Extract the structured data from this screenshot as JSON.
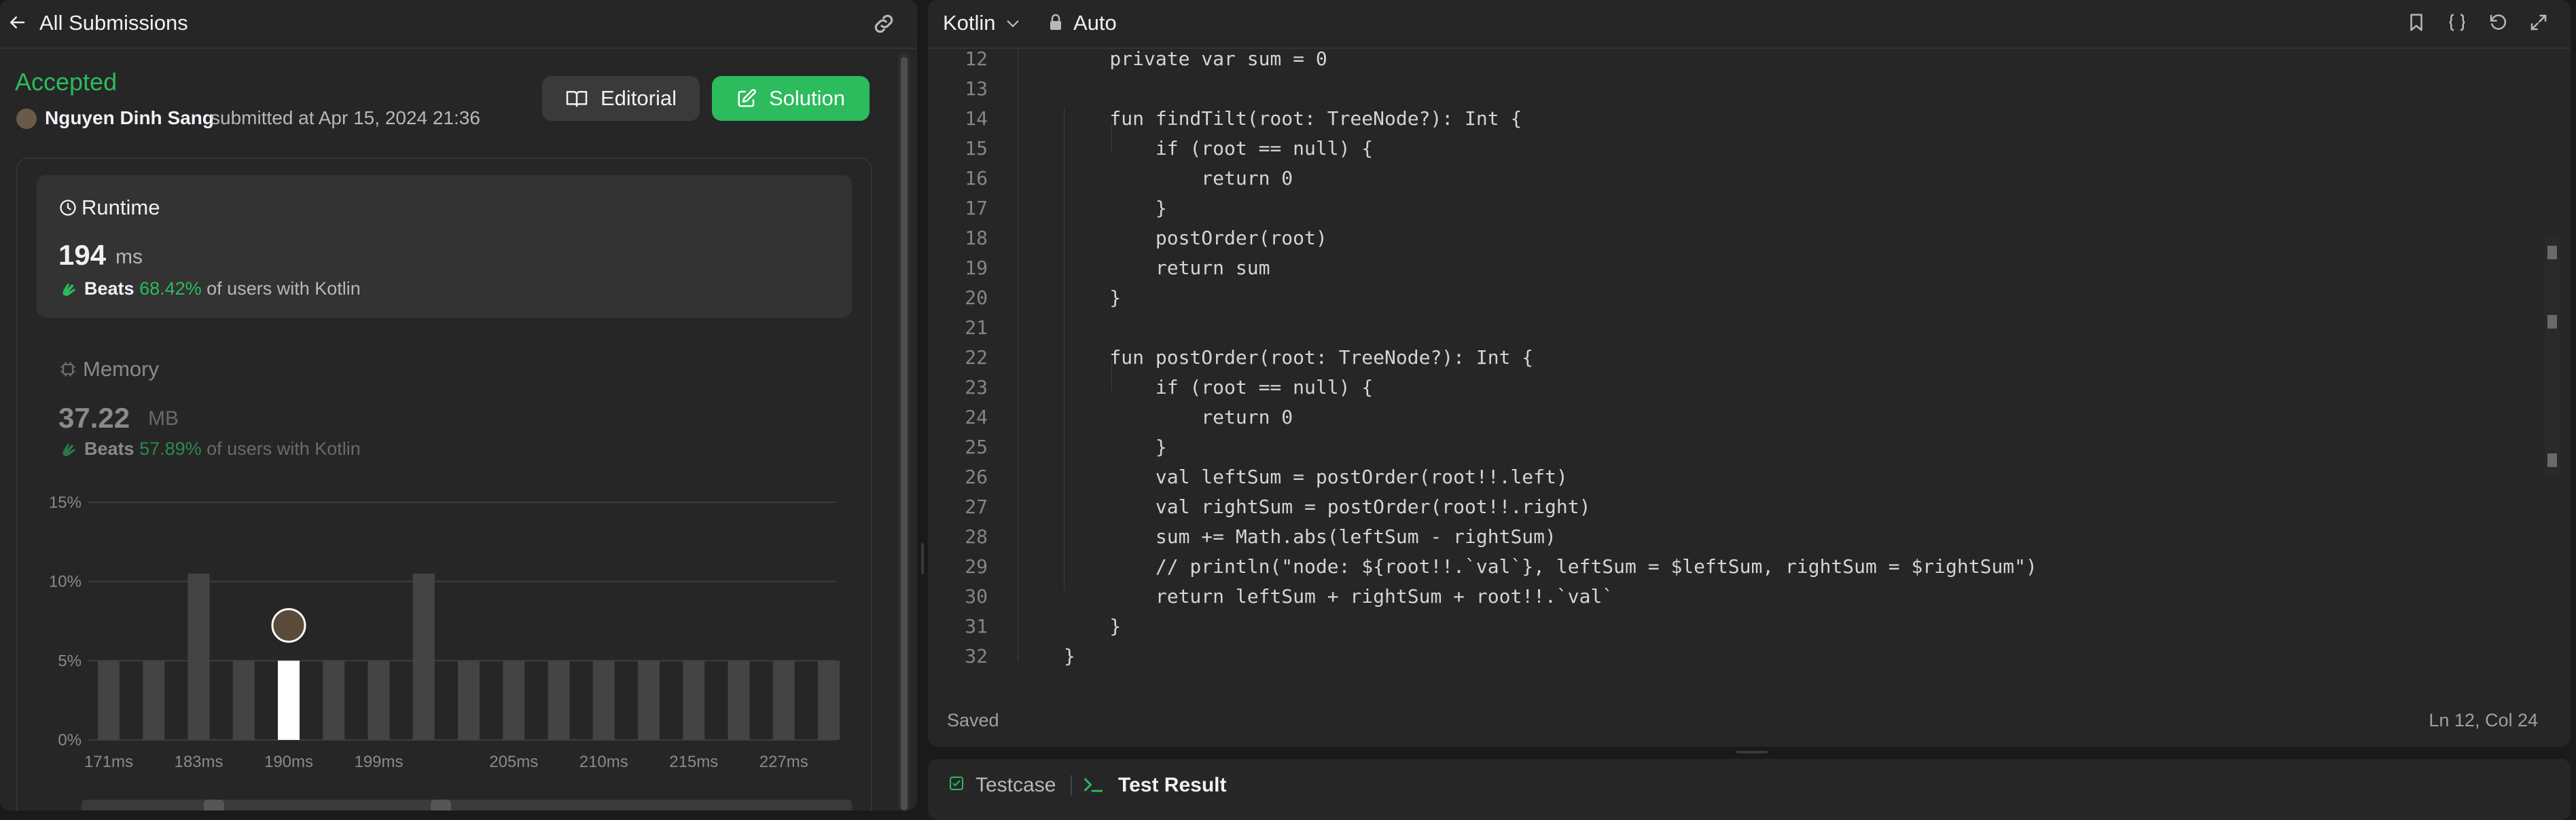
{
  "left_panel": {
    "header": {
      "title": "All Submissions"
    },
    "submission": {
      "status": "Accepted",
      "submitter": "Nguyen Dinh Sang",
      "submitted_text": "submitted at Apr 15, 2024 21:36"
    },
    "buttons": {
      "editorial": "Editorial",
      "solution": "Solution"
    },
    "runtime": {
      "label": "Runtime",
      "value": "194",
      "unit": "ms",
      "beats_prefix": "Beats",
      "beats_pct": "68.42%",
      "beats_suffix": "of users with Kotlin"
    },
    "memory": {
      "label": "Memory",
      "value": "37.22",
      "unit": "MB",
      "beats_prefix": "Beats",
      "beats_pct": "57.89%",
      "beats_suffix": "of users with Kotlin"
    }
  },
  "chart_data": {
    "type": "bar",
    "title": "",
    "xlabel": "",
    "ylabel": "",
    "ylim": [
      0,
      15
    ],
    "y_ticks": [
      "0%",
      "5%",
      "10%",
      "15%"
    ],
    "x_tick_labels": [
      "171ms",
      "183ms",
      "190ms",
      "199ms",
      "205ms",
      "210ms",
      "215ms",
      "227ms"
    ],
    "values": [
      5,
      5,
      10.5,
      5,
      5,
      5,
      5,
      10.5,
      5,
      5,
      5,
      5,
      5,
      5,
      5,
      5,
      5
    ],
    "highlight_index": 4,
    "grid": true,
    "colors": {
      "bar": "#444444",
      "highlight": "#ffffff",
      "grid": "#3e3e3e"
    }
  },
  "editor": {
    "language": "Kotlin",
    "mode": "Auto",
    "status": "Saved",
    "cursor_position": "Ln 12, Col 24",
    "lines": [
      {
        "n": "12",
        "t": "    private var sum = 0"
      },
      {
        "n": "13",
        "t": ""
      },
      {
        "n": "14",
        "t": "    fun findTilt(root: TreeNode?): Int {"
      },
      {
        "n": "15",
        "t": "        if (root == null) {"
      },
      {
        "n": "16",
        "t": "            return 0"
      },
      {
        "n": "17",
        "t": "        }"
      },
      {
        "n": "18",
        "t": "        postOrder(root)"
      },
      {
        "n": "19",
        "t": "        return sum"
      },
      {
        "n": "20",
        "t": "    }"
      },
      {
        "n": "21",
        "t": ""
      },
      {
        "n": "22",
        "t": "    fun postOrder(root: TreeNode?): Int {"
      },
      {
        "n": "23",
        "t": "        if (root == null) {"
      },
      {
        "n": "24",
        "t": "            return 0"
      },
      {
        "n": "25",
        "t": "        }"
      },
      {
        "n": "26",
        "t": "        val leftSum = postOrder(root!!.left)"
      },
      {
        "n": "27",
        "t": "        val rightSum = postOrder(root!!.right)"
      },
      {
        "n": "28",
        "t": "        sum += Math.abs(leftSum - rightSum)"
      },
      {
        "n": "29",
        "t": "        // println(\"node: ${root!!.`val`}, leftSum = $leftSum, rightSum = $rightSum\")"
      },
      {
        "n": "30",
        "t": "        return leftSum + rightSum + root!!.`val`"
      },
      {
        "n": "31",
        "t": "    }"
      },
      {
        "n": "32",
        "t": "}"
      }
    ]
  },
  "bottom_tabs": {
    "testcase": "Testcase",
    "test_result": "Test Result"
  },
  "colors": {
    "accent_green": "#2cbb5d",
    "panel_bg": "#262626",
    "app_bg": "#1a1a1a"
  }
}
